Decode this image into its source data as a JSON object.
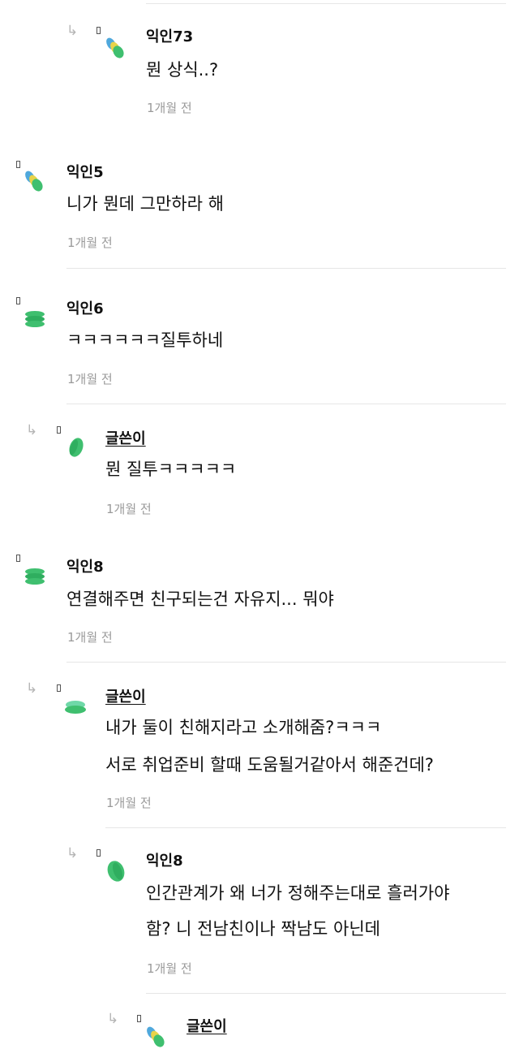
{
  "comments": [
    {
      "author": "익인73",
      "lines": [
        "뭔 상식..?"
      ],
      "time": "1개월 전",
      "is_reply": true,
      "is_op": false
    },
    {
      "author": "익인5",
      "lines": [
        "니가 뭔데 그만하라 해"
      ],
      "time": "1개월 전",
      "is_reply": false,
      "is_op": false
    },
    {
      "author": "익인6",
      "lines": [
        "ㅋㅋㅋㅋㅋㅋ질투하네"
      ],
      "time": "1개월 전",
      "is_reply": false,
      "is_op": false
    },
    {
      "author": "글쓴이",
      "lines": [
        "뭔 질투ㅋㅋㅋㅋㅋ"
      ],
      "time": "1개월 전",
      "is_reply": true,
      "is_op": true
    },
    {
      "author": "익인8",
      "lines": [
        "연결해주면 친구되는건 자유지... 뭐야"
      ],
      "time": "1개월 전",
      "is_reply": false,
      "is_op": false
    },
    {
      "author": "글쓴이",
      "lines": [
        "내가 둘이 친해지라고 소개해줌?ㅋㅋㅋ",
        "서로 취업준비 할때 도움될거같아서 해준건데?"
      ],
      "time": "1개월 전",
      "is_reply": true,
      "is_op": true
    },
    {
      "author": "익인8",
      "lines": [
        "인간관계가 왜 너가 정해주는대로 흘러가야",
        "함? 니 전남친이나 짝남도 아닌데"
      ],
      "time": "1개월 전",
      "is_reply": true,
      "is_op": false
    },
    {
      "author": "글쓴이",
      "lines": [],
      "time": "",
      "is_reply": true,
      "is_op": true
    }
  ],
  "icons": {
    "reply": "reply-arrow-icon"
  },
  "colors": {
    "avatar_blue": "#4fa8dc",
    "avatar_yellow": "#e8d34a",
    "avatar_green": "#3fbf6f",
    "time": "#9a9a9a",
    "divider": "#e6e6e6"
  }
}
